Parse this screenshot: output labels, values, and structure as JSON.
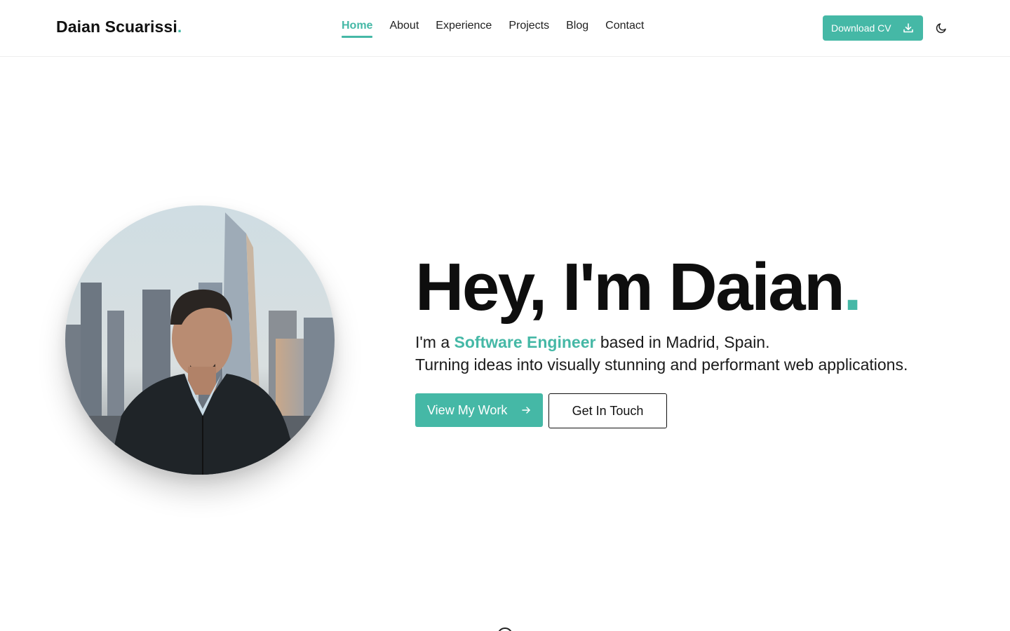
{
  "header": {
    "brand_name": "Daian Scuarissi",
    "brand_dot": ".",
    "nav": [
      {
        "label": "Home",
        "active": true
      },
      {
        "label": "About",
        "active": false
      },
      {
        "label": "Experience",
        "active": false
      },
      {
        "label": "Projects",
        "active": false
      },
      {
        "label": "Blog",
        "active": false
      },
      {
        "label": "Contact",
        "active": false
      }
    ],
    "download_label": "Download CV",
    "download_icon": "download-icon",
    "theme_icon": "moon-icon"
  },
  "hero": {
    "title": "Hey, I'm Daian",
    "title_dot": ".",
    "line1_prefix": "I'm a ",
    "line1_accent": "Software Engineer",
    "line1_suffix": " based in Madrid, Spain.",
    "line2": "Turning ideas into visually stunning and performant web applications.",
    "primary_cta": "View My Work",
    "primary_cta_icon": "arrow-right-icon",
    "secondary_cta": "Get In Touch"
  },
  "colors": {
    "accent": "#45b8a6",
    "text": "#111111",
    "background": "#ffffff"
  }
}
